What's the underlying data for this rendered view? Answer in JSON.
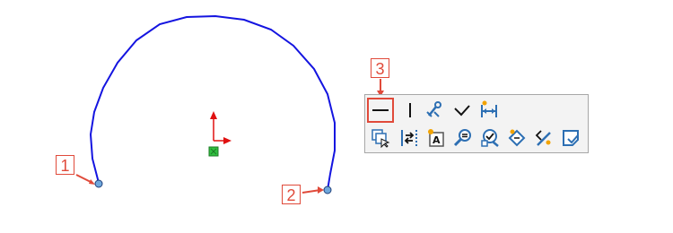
{
  "callouts": {
    "c1": "1",
    "c2": "2",
    "c3": "3"
  },
  "colors": {
    "arc": "#1414e0",
    "endpoint": "#6fa8dc",
    "callout": "#e04a3a",
    "origin_arrow": "#e01010",
    "origin_square": "#2fbf3f",
    "toolbar_bg": "#f3f3f3",
    "toolbar_border": "#a7a7a7",
    "icon_blue": "#2d6fb3"
  },
  "toolbar": {
    "row1": [
      {
        "icon": "horizontal-relation-icon",
        "selected": true
      },
      {
        "icon": "vertical-relation-icon"
      },
      {
        "icon": "fix-relation-icon"
      },
      {
        "icon": "checkmark-icon"
      },
      {
        "icon": "smart-dimension-icon"
      }
    ],
    "row2": [
      {
        "icon": "select-other-icon"
      },
      {
        "icon": "convert-entities-icon"
      },
      {
        "icon": "add-text-icon"
      },
      {
        "icon": "zoom-to-selection-icon"
      },
      {
        "icon": "view-sketch-relations-icon"
      },
      {
        "icon": "sketch-tool-1-icon"
      },
      {
        "icon": "sketch-tool-2-icon"
      },
      {
        "icon": "exit-sketch-icon"
      }
    ]
  }
}
